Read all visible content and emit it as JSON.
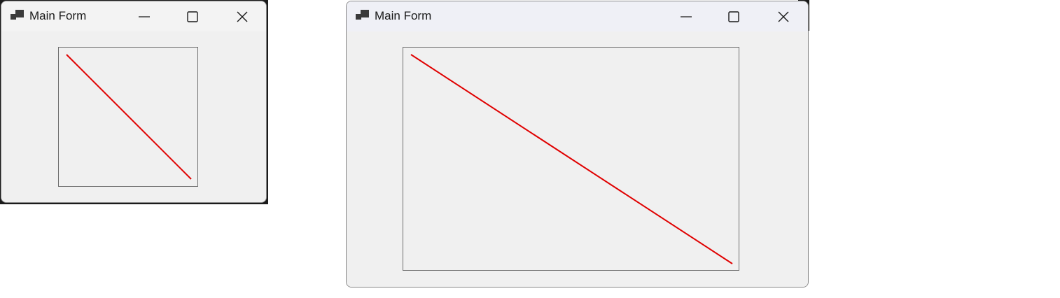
{
  "colors": {
    "window_background": "#f0f0f0",
    "line": "#e00000",
    "panel_border": "#6e6e6e"
  },
  "windows": [
    {
      "title": "Main Form",
      "icon": "app-windows-icon",
      "controls": [
        "minimize-icon",
        "maximize-icon",
        "close-icon"
      ]
    },
    {
      "title": "Main Form",
      "icon": "app-windows-icon",
      "controls": [
        "minimize-icon",
        "maximize-icon",
        "close-icon"
      ]
    }
  ]
}
